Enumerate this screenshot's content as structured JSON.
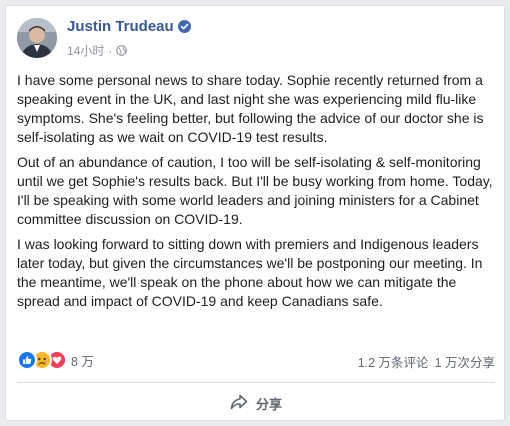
{
  "post": {
    "author": "Justin Trudeau",
    "timestamp": "14小时",
    "meta_separator": "·",
    "paragraphs": [
      "I have some personal news to share today. Sophie recently returned from a speaking event in the UK, and last night she was experiencing mild flu-like symptoms. She's feeling better, but following the advice of our doctor she is self-isolating as we wait on COVID-19 test results.",
      "Out of an abundance of caution, I too will be self-isolating & self-monitoring until we get Sophie's results back. But I'll be busy working from home. Today, I'll be speaking with some world leaders and joining ministers for a Cabinet committee discussion on COVID-19.",
      "I was looking forward to sitting down with premiers and Indigenous leaders later today, but given the circumstances we'll be postponing our meeting. In the meantime, we'll speak on the phone about how we can mitigate the spread and impact of COVID-19 and keep Canadians safe."
    ]
  },
  "stats": {
    "reaction_count": "8 万",
    "comments": "1.2 万条评论",
    "shares": "1 万次分享"
  },
  "actions": {
    "share_label": "分享"
  },
  "icons": {
    "avatar": "profile-photo",
    "verified": "verified-badge-icon",
    "privacy": "globe-icon",
    "reactions": [
      "like-icon",
      "sad-icon",
      "love-icon"
    ],
    "share": "share-arrow-icon"
  },
  "colors": {
    "author_link": "#385898",
    "verified": "#4267b2",
    "like": "#1877f2",
    "sad": "#f7b928",
    "love": "#f33e58",
    "secondary_text": "#606770"
  }
}
